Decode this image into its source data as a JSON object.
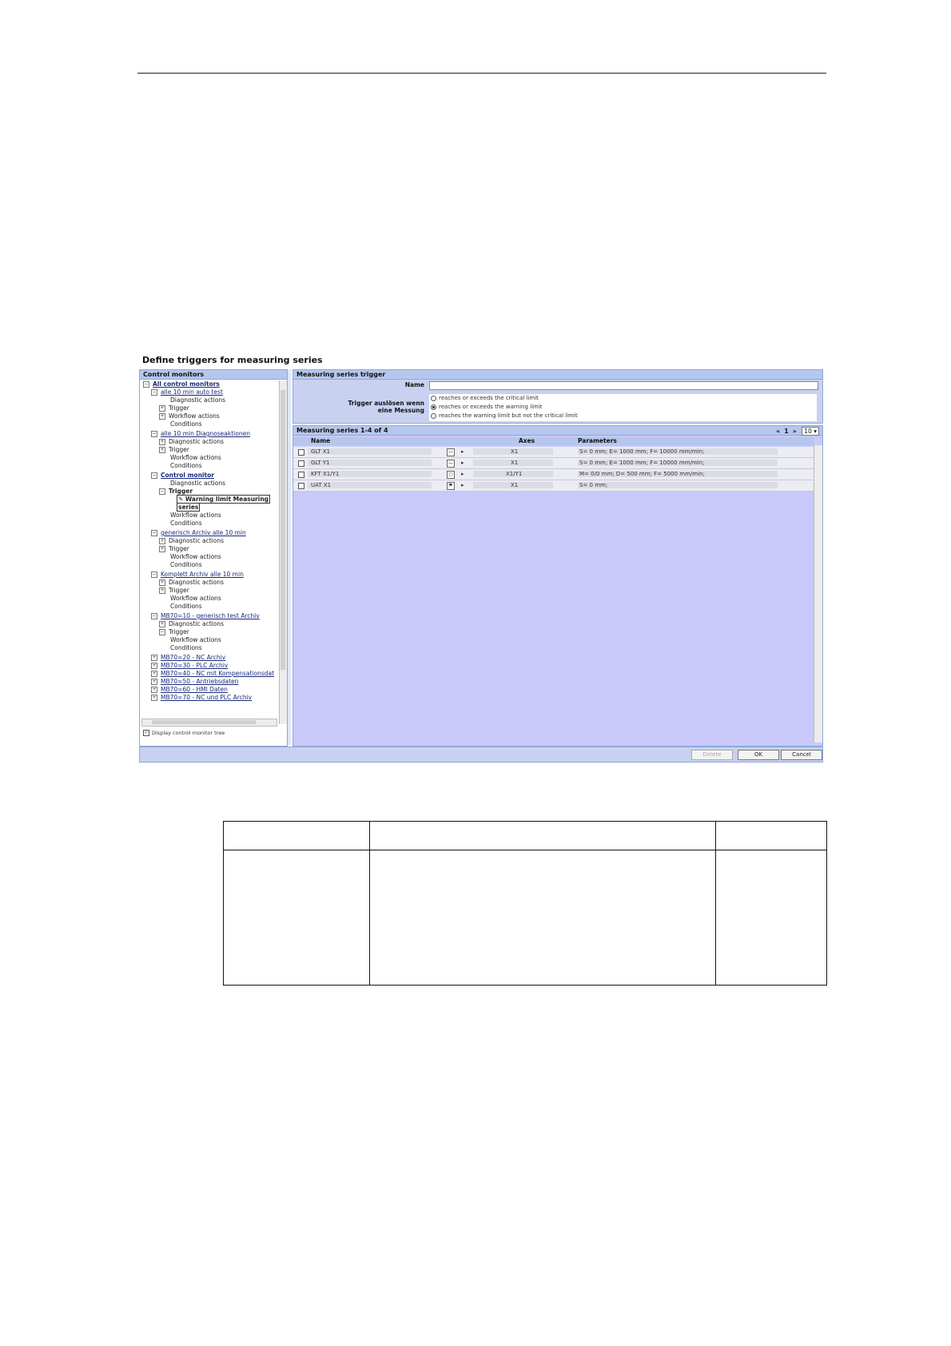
{
  "screenshot_title": "Define triggers for measuring series",
  "tree_pane": {
    "title": "Control monitors",
    "nodes": [
      {
        "text": "All control monitors"
      },
      {
        "text": "alle 10 min auto test"
      },
      {
        "text": "Diagnostic actions"
      },
      {
        "text": "Trigger"
      },
      {
        "text": "Workflow actions"
      },
      {
        "text": "Conditions"
      },
      {
        "text": "alle 10 min Diagnoseaktionen"
      },
      {
        "text": "Diagnostic actions"
      },
      {
        "text": "Trigger"
      },
      {
        "text": "Workflow actions"
      },
      {
        "text": "Conditions"
      },
      {
        "text": "Control monitor"
      },
      {
        "text": "Diagnostic actions"
      },
      {
        "text": "Trigger"
      },
      {
        "text": "Warning limit Measuring"
      },
      {
        "text": "series"
      },
      {
        "text": "Workflow actions"
      },
      {
        "text": "Conditions"
      },
      {
        "text": "generisch Archiv alle 10 min"
      },
      {
        "text": "Diagnostic actions"
      },
      {
        "text": "Trigger"
      },
      {
        "text": "Workflow actions"
      },
      {
        "text": "Conditions"
      },
      {
        "text": "Komplett Archiv alle 10 min"
      },
      {
        "text": "Diagnostic actions"
      },
      {
        "text": "Trigger"
      },
      {
        "text": "Workflow actions"
      },
      {
        "text": "Conditions"
      },
      {
        "text": "MB70=10 - generisch test Archiv"
      },
      {
        "text": "Diagnostic actions"
      },
      {
        "text": "Trigger"
      },
      {
        "text": "Workflow actions"
      },
      {
        "text": "Conditions"
      },
      {
        "text": "MB70=20 - NC Archiv"
      },
      {
        "text": "MB70=30 - PLC Archiv"
      },
      {
        "text": "MB70=40 - NC mit Kompensationsdat"
      },
      {
        "text": "MB70=50 - Antriebsdaten"
      },
      {
        "text": "MB70=60 - HMI Daten"
      },
      {
        "text": "MB70=70 - NC und PLC Archiv"
      }
    ],
    "display_tree_label": "Display control monitor tree"
  },
  "trigger_panel": {
    "title": "Measuring series trigger",
    "name_label": "Name",
    "name_value": "",
    "trigger_label_1": "Trigger auslösen wenn",
    "trigger_label_2": "eine Messung",
    "options": [
      "reaches or exceeds the critical limit",
      "reaches or exceeds the warning limit",
      "reaches the warning limit but not the critical limit"
    ],
    "selected_option": 1
  },
  "series_panel": {
    "title": "Measuring series 1-4 of 4",
    "pager": {
      "first": "«",
      "page": "1",
      "next": "»",
      "page_size": "10"
    },
    "columns": {
      "name": "Name",
      "axes": "Axes",
      "parameters": "Parameters"
    },
    "rows": [
      {
        "name": "GLT X1",
        "icon": "line-icon",
        "axes": "X1",
        "parameters": "S= 0 mm; E= 1000 mm; F= 10000 mm/min;"
      },
      {
        "name": "GLT Y1",
        "icon": "line-icon",
        "axes": "X1",
        "parameters": "S= 0 mm; E= 1000 mm; F= 10000 mm/min;"
      },
      {
        "name": "KFT X1/Y1",
        "icon": "circle-icon",
        "axes": "X1/Y1",
        "parameters": "M= 0/0 mm; D= 500 mm; F= 5000 mm/min;"
      },
      {
        "name": "UAT X1",
        "icon": "flag-icon",
        "axes": "X1",
        "parameters": "S= 0 mm;"
      }
    ]
  },
  "footer": {
    "delete_label": "Delete",
    "ok_label": "OK",
    "cancel_label": "Cancel"
  }
}
